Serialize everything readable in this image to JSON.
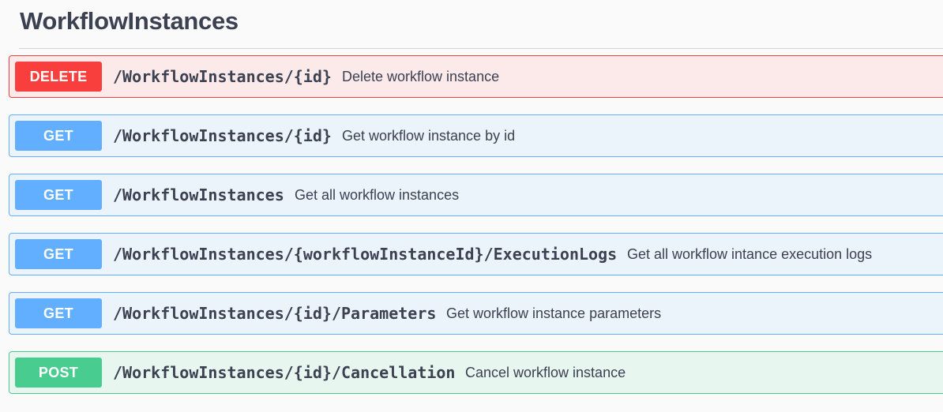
{
  "section": {
    "title": "WorkflowInstances"
  },
  "operations": [
    {
      "method": "DELETE",
      "path": "/WorkflowInstances/{id}",
      "summary": "Delete workflow instance"
    },
    {
      "method": "GET",
      "path": "/WorkflowInstances/{id}",
      "summary": "Get workflow instance by id"
    },
    {
      "method": "GET",
      "path": "/WorkflowInstances",
      "summary": "Get all workflow instances"
    },
    {
      "method": "GET",
      "path": "/WorkflowInstances/{workflowInstanceId}/ExecutionLogs",
      "summary": "Get all workflow intance execution logs"
    },
    {
      "method": "GET",
      "path": "/WorkflowInstances/{id}/Parameters",
      "summary": "Get workflow instance parameters"
    },
    {
      "method": "POST",
      "path": "/WorkflowInstances/{id}/Cancellation",
      "summary": "Cancel workflow instance"
    }
  ],
  "colors": {
    "delete": "#f93e3e",
    "get": "#61affe",
    "post": "#49cc90",
    "text": "#3b4151"
  }
}
